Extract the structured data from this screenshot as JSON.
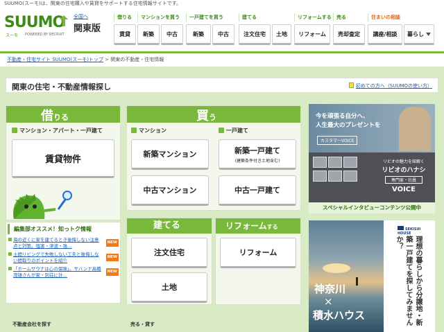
{
  "topbar": {
    "text": "SUUMO(スーモ)は、関東の住宅購入や賃貸をサポートする住宅情報サイトです。"
  },
  "header": {
    "logo": {
      "word": "SUUMO",
      "sub": "スーモ",
      "by": "POWERED BY RECRUIT"
    },
    "region": {
      "to": "全国へ",
      "name": "関東版"
    },
    "nav": [
      {
        "cat": "借りる",
        "items": [
          "賃貸"
        ]
      },
      {
        "cat": "マンションを買う",
        "items": [
          "新築",
          "中古"
        ]
      },
      {
        "cat": "一戸建てを買う",
        "items": [
          "新築",
          "中古"
        ]
      },
      {
        "cat": "建てる",
        "items": [
          "注文住宅",
          "土地"
        ]
      },
      {
        "cat": "リフォームする",
        "items": [
          "リフォーム"
        ]
      },
      {
        "cat": "売る",
        "items": [
          "売却査定"
        ]
      },
      {
        "cat": "住まいの相談",
        "items": [
          "講座/相談",
          "暮らし"
        ]
      }
    ]
  },
  "breadcrumb": {
    "link": "不動産・住宅サイト SUUMO(スーモ)トップ",
    "sep": ">",
    "current": "関東の不動産・住宅情報"
  },
  "page": {
    "title": "関東の住宅・不動産情報探し",
    "first_link": "初めての方へ（SUUMOの使い方）"
  },
  "rent": {
    "head_big": "借",
    "head_small": "りる",
    "sub": "マンション・アパート・一戸建て",
    "btn": "賃貸物件"
  },
  "buy": {
    "head_big": "買",
    "head_small": "う",
    "mansion_label": "マンション",
    "house_label": "一戸建て",
    "new_mansion": "新築マンション",
    "used_mansion": "中古マンション",
    "new_house": "新築一戸建て",
    "new_house_note": "(建築条件付き土地含む)",
    "used_house": "中古一戸建て"
  },
  "build": {
    "head": "建てる",
    "order": "注文住宅",
    "land": "土地"
  },
  "reform": {
    "head_big": "リフォーム",
    "head_small": "する",
    "btn": "リフォーム"
  },
  "osusume": {
    "title": "編集部オススメ！知っトク情報",
    "items": [
      {
        "text": "海の近くに家を建てるとき後悔しない注意点と対策。塩害・津波・強…",
        "badge": "NEW"
      },
      {
        "text": "土間リビングで失敗しない工夫と後悔しない間取りのポイントを紹介",
        "badge": "NEW"
      },
      {
        "text": "「ホームサウナは心の保険」。サバンナ高橋茂雄さんが家・別荘に計…",
        "badge": "NEW"
      }
    ]
  },
  "bottom": {
    "left_label": "不動産会社を探す",
    "mid_label": "売る・貸す"
  },
  "ad1": {
    "line1": "今を頑張る自分へ、",
    "line2": "人生最大のプレゼントを",
    "voice_tag": "カスタマーVOICE",
    "lead": "リビオの魅力を紐解く",
    "brand": "リビオのハナシ",
    "tag2": "専門家・社員",
    "voice": "VOICE",
    "bar": "スペシャルインタビューコンテンツ公開中"
  },
  "ad2": {
    "logo": "SEKISUI HOUSE",
    "kanagawa": "神奈川",
    "x": "×",
    "sekisui": "積水ハウス",
    "vertical": "理想の暮らしから分譲地・新築一戸建てを探してみませんか？"
  },
  "colors": {
    "brand_green": "#3d8c19",
    "accent_green": "#7ab83b",
    "new_badge": "#ef7a17",
    "link": "#1a5fb4"
  }
}
